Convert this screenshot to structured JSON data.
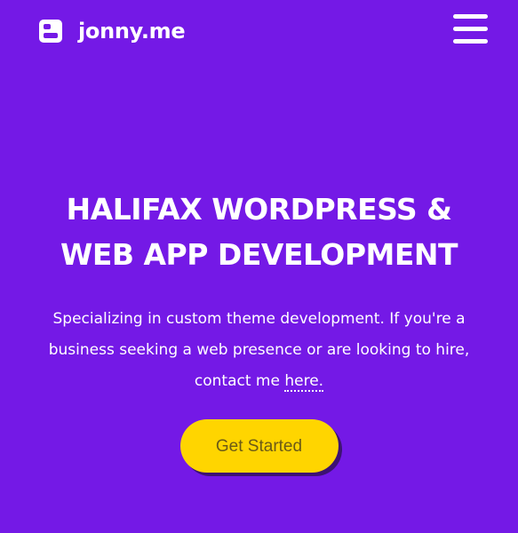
{
  "header": {
    "brand_name": "jonny.me",
    "logo_icon": "layout-stack-icon",
    "menu_icon": "hamburger-menu-icon"
  },
  "hero": {
    "title_line1": "HALIFAX WORDPRESS &",
    "title_line2": "WEB APP DEVELOPMENT",
    "text_before_link": "Specializing in custom theme development. If you're a business seeking a web presence or are looking to hire, contact me ",
    "link_text": "here.",
    "cta_label": "Get Started"
  },
  "colors": {
    "background": "#7419e6",
    "text": "#ffffff",
    "cta_background": "#ffd500",
    "cta_text": "#6b5a17"
  }
}
